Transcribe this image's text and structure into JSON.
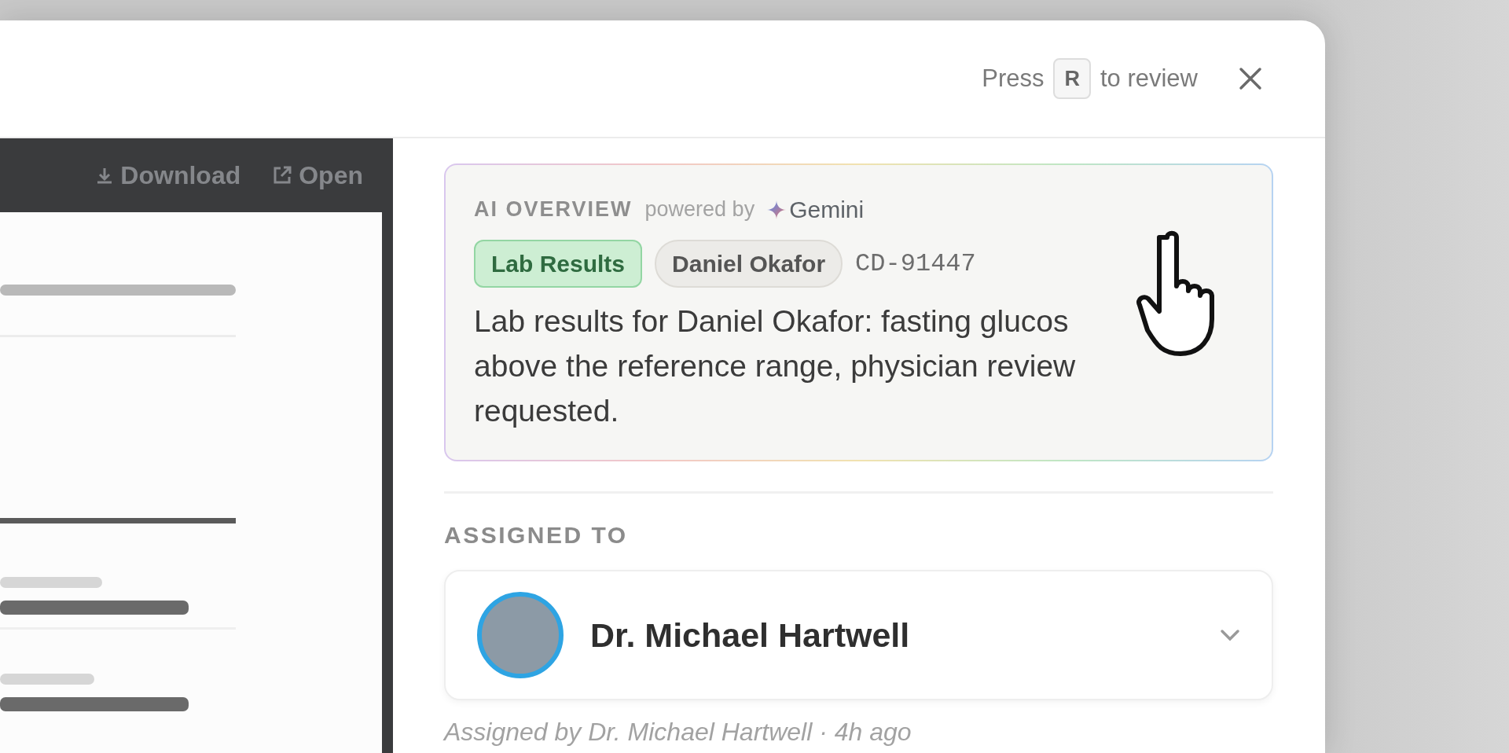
{
  "header": {
    "hint_before": "Press",
    "key": "R",
    "hint_after": "to review"
  },
  "document_toolbar": {
    "actions": [
      {
        "label": "Download",
        "kind": "download"
      },
      {
        "label": "Open",
        "kind": "open"
      }
    ]
  },
  "ai_overview": {
    "title": "AI OVERVIEW",
    "powered_by": "powered by",
    "brand": "Gemini",
    "tags": [
      {
        "label": "Lab Results",
        "kind": "category"
      },
      {
        "label": "Daniel Okafor",
        "kind": "patient"
      }
    ],
    "case_id": "CD-91447",
    "summary": "Lab results for Daniel Okafor: fasting glucos\nabove the reference range, physician review\nrequested."
  },
  "assignment": {
    "title": "ASSIGNED TO",
    "assignee": "Dr. Michael Hartwell",
    "note": "Assigned by Dr. Michael Hartwell · 4h ago"
  }
}
